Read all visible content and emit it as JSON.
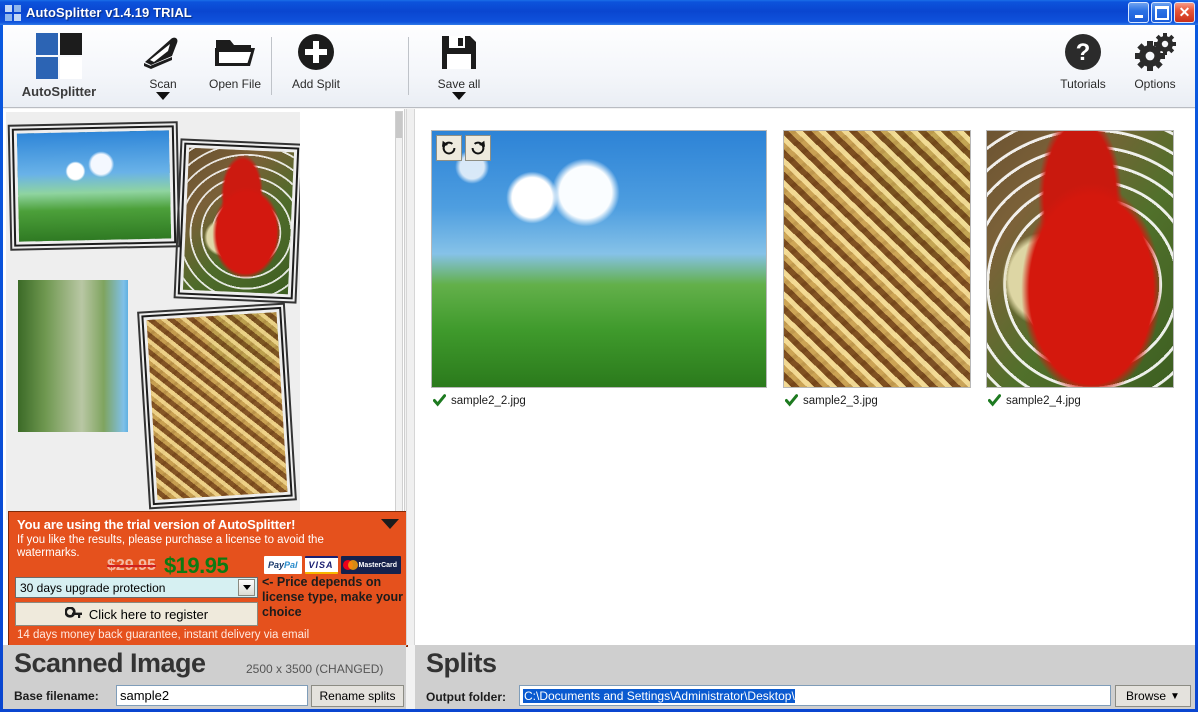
{
  "window": {
    "title": "AutoSplitter v1.4.19 TRIAL",
    "icon": "app-squares-icon",
    "minimize_label": "Minimize",
    "maximize_label": "Maximize",
    "close_label": "✕"
  },
  "toolbar": {
    "brand_label": "AutoSplitter",
    "items": [
      {
        "label": "Scan",
        "icon": "scanner-icon",
        "has_dropdown": true
      },
      {
        "label": "Open File",
        "icon": "folder-open-icon",
        "has_dropdown": false
      },
      {
        "label": "Add Split",
        "icon": "plus-circle-icon",
        "has_dropdown": false
      },
      {
        "label": "Save all",
        "icon": "floppy-disk-icon",
        "has_dropdown": true
      }
    ],
    "right_items": [
      {
        "label": "Tutorials",
        "icon": "question-circle-icon"
      },
      {
        "label": "Options",
        "icon": "gears-icon"
      }
    ]
  },
  "scan_preview": {
    "photos": [
      {
        "name": "photo-morning-glory",
        "rotation": "-1.2deg"
      },
      {
        "name": "photo-fly-agaric",
        "rotation": "2.5deg"
      },
      {
        "name": "photo-meadow",
        "rotation": "0deg"
      },
      {
        "name": "photo-autumn-leaves",
        "rotation": "-3.5deg"
      }
    ]
  },
  "trial_banner": {
    "title": "You are using the trial version of AutoSplitter!",
    "subtitle": "If you like the results, please purchase a license to avoid the watermarks.",
    "old_price": "$29.95",
    "new_price": "$19.95",
    "payment_logos": [
      "PayPal",
      "VISA",
      "MasterCard"
    ],
    "license_option": "30 days upgrade protection",
    "register_label": "Click here to register",
    "price_note": "<- Price depends on license type, make your choice",
    "guarantee": "14 days money back guarantee, instant delivery via email",
    "collapse_icon": "collapse-triangle-icon",
    "bg_color": "#e5511d",
    "price_color": "#0d7a12"
  },
  "splits": {
    "rotate_ccw_label": "Rotate left",
    "rotate_cw_label": "Rotate right",
    "items": [
      {
        "filename": "sample2_2.jpg",
        "status": "saved",
        "image": "photo-morning-glory"
      },
      {
        "filename": "sample2_3.jpg",
        "status": "saved",
        "image": "photo-autumn-leaves"
      },
      {
        "filename": "sample2_4.jpg",
        "status": "saved",
        "image": "photo-fly-agaric"
      }
    ]
  },
  "scanned_image_bar": {
    "title": "Scanned Image",
    "dimensions": "2500 x 3500 (CHANGED)",
    "base_filename_label": "Base filename:",
    "base_filename_value": "sample2",
    "base_filename_placeholder": "Base filename",
    "rename_button": "Rename splits"
  },
  "splits_bar": {
    "title": "Splits",
    "output_folder_label": "Output folder:",
    "output_folder_value": "C:\\Documents and Settings\\Administrator\\Desktop\\",
    "output_folder_placeholder": "Output folder",
    "browse_button": "Browse",
    "browse_arrow": "▼"
  }
}
